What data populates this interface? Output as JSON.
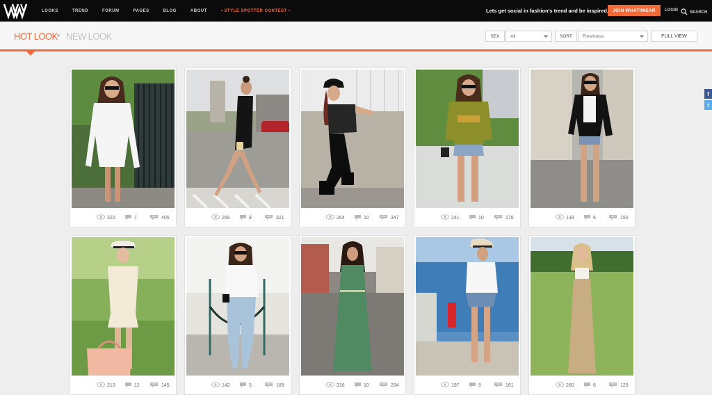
{
  "header": {
    "nav": [
      "LOOKS",
      "TREND",
      "FORUM",
      "PAGES",
      "BLOG",
      "ABOUT",
      "• STYLE SPOTTER CONTEST •"
    ],
    "tagline": "Lets get social in fashion's trend and be inspired.",
    "join_label": "JOIN WHATIWEAR",
    "login_label": "LOGIN",
    "search_label": "SEARCH"
  },
  "tabs": {
    "hot": "HOT LOOK",
    "new": "NEW LOOK"
  },
  "filters": {
    "sex_label": "SEX",
    "sex_value": "All",
    "sort_label": "SORT",
    "sort_value": "Freshness",
    "fullview_label": "FULL VIEW"
  },
  "social": {
    "facebook": "f",
    "twitter": "t"
  },
  "colors": {
    "accent": "#f26a3a",
    "topbar": "#0b0b0b",
    "background": "#eeeeee"
  },
  "looks": [
    {
      "views": "322",
      "likes": "7",
      "comments": "405"
    },
    {
      "views": "268",
      "likes": "8",
      "comments": "321"
    },
    {
      "views": "264",
      "likes": "10",
      "comments": "347"
    },
    {
      "views": "241",
      "likes": "10",
      "comments": "176"
    },
    {
      "views": "139",
      "likes": "6",
      "comments": "150"
    },
    {
      "views": "213",
      "likes": "12",
      "comments": "145"
    },
    {
      "views": "142",
      "likes": "5",
      "comments": "189"
    },
    {
      "views": "316",
      "likes": "10",
      "comments": "294"
    },
    {
      "views": "197",
      "likes": "5",
      "comments": "161"
    },
    {
      "views": "280",
      "likes": "6",
      "comments": "129"
    }
  ]
}
